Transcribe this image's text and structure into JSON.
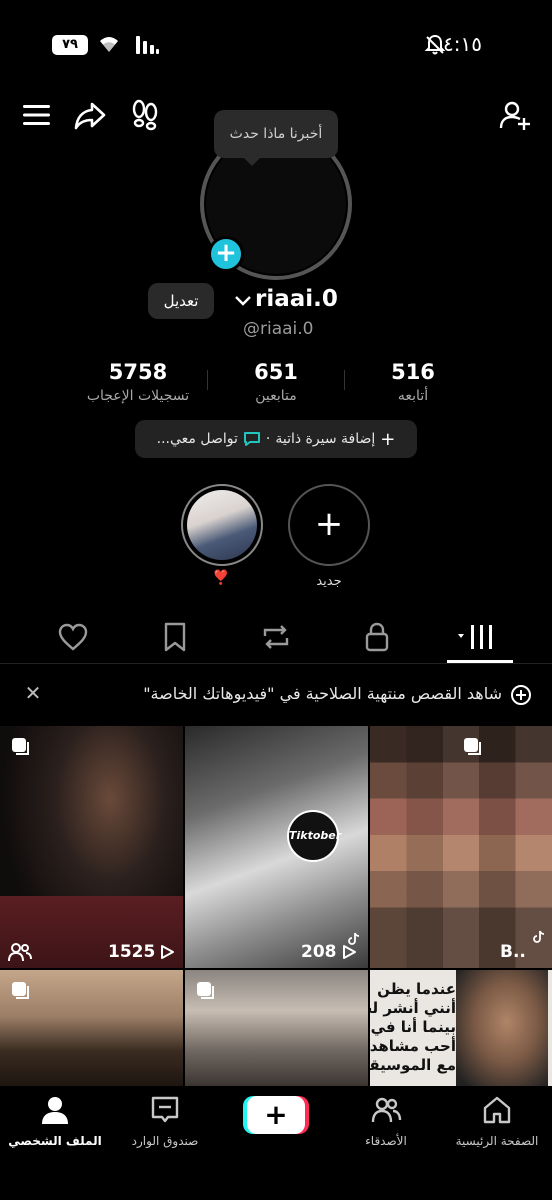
{
  "status_bar": {
    "time": "٤:١٥",
    "battery": "٧٩"
  },
  "topbar": {
    "tooltip": "أخبرنا ماذا حدث"
  },
  "profile": {
    "username": "riaai.0",
    "handle": "@riaai.0",
    "edit_label": "تعديل"
  },
  "stats": [
    {
      "value": "5758",
      "label": "تسجيلات الإعجاب"
    },
    {
      "value": "651",
      "label": "متابعين"
    },
    {
      "value": "516",
      "label": "أتابعه"
    }
  ],
  "bio": {
    "add_bio": "إضافة سيرة ذاتية",
    "separator": "·",
    "contact": "تواصل معي..."
  },
  "highlights": {
    "story_emoji": "❣️",
    "new_label": "جديد"
  },
  "tabs": {
    "icons": [
      "videos-grid-icon",
      "lock-icon",
      "repost-icon",
      "bookmark-icon",
      "heart-icon"
    ],
    "active": "videos-grid-icon"
  },
  "notice": {
    "text": "شاهد القصص منتهية الصلاحية في \"فيديوهاتك الخاصة\""
  },
  "grid": {
    "tiles": [
      {
        "views": "1525"
      },
      {
        "views": "208",
        "sticker": "Tiktober"
      },
      {
        "views": "B.."
      },
      {
        "views": ""
      },
      {
        "views": ""
      },
      {
        "text_lines": [
          "عندما يظن",
          "أنني أنشر لجنب",
          "بينما أنا في الح",
          "أحب مشاهدة نف",
          "مع الموسيقى"
        ]
      }
    ]
  },
  "bottom_nav": {
    "home": "الصفحة الرئيسية",
    "friends": "الأصدقاء",
    "create": "+",
    "inbox": "صندوق الوارد",
    "profile": "الملف الشخصي",
    "active": "profile"
  }
}
